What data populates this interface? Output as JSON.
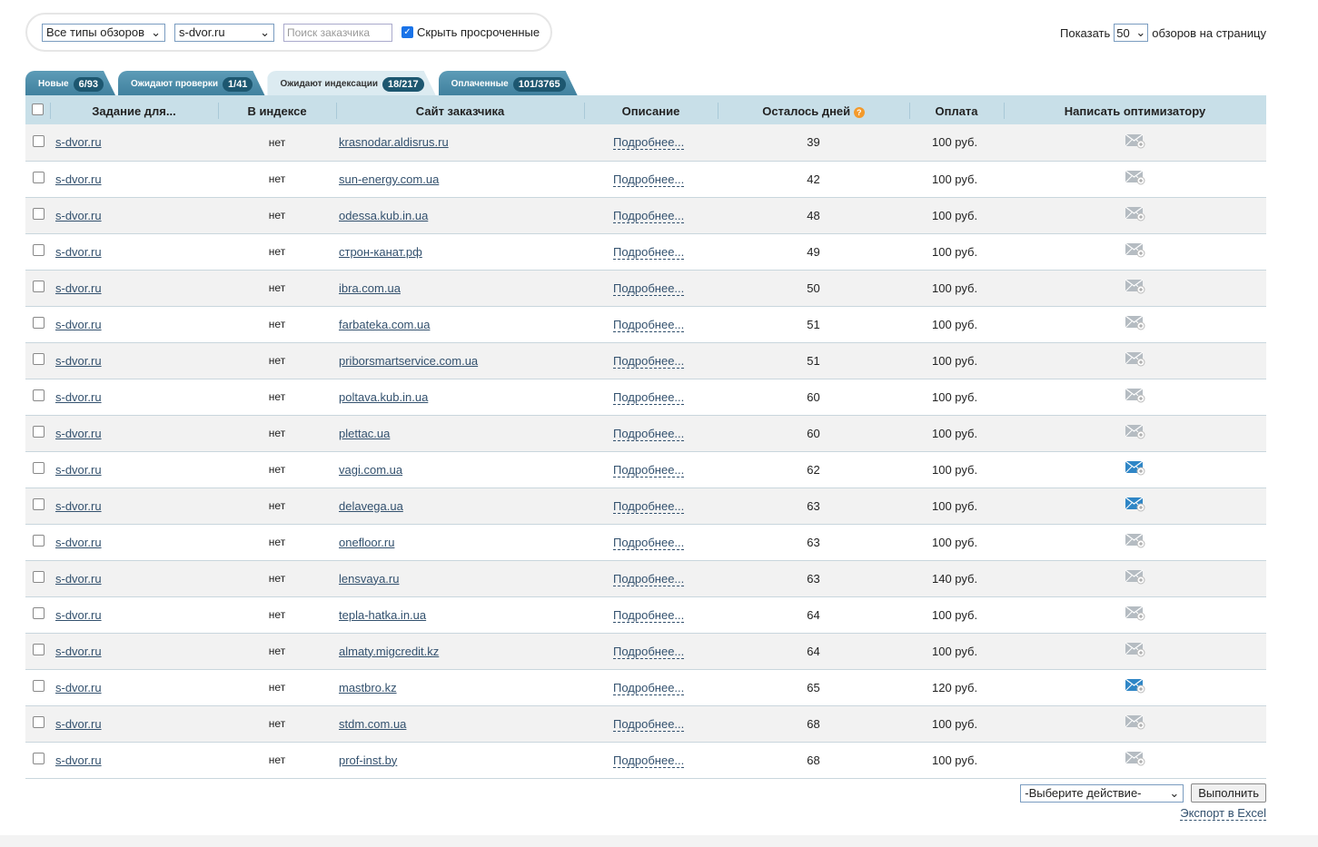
{
  "filters": {
    "review_type": "Все типы обзоров",
    "site": "s-dvor.ru",
    "search_placeholder": "Поиск заказчика",
    "hide_expired_label": "Скрыть просроченные",
    "hide_expired_checked": true
  },
  "per_page": {
    "prefix": "Показать",
    "value": "50",
    "suffix": "обзоров на страницу"
  },
  "tabs": [
    {
      "label": "Новые",
      "count": "6/93"
    },
    {
      "label": "Ожидают проверки",
      "count": "1/41"
    },
    {
      "label": "Ожидают индексации",
      "count": "18/217",
      "active": true
    },
    {
      "label": "Оплаченные",
      "count": "101/3765"
    }
  ],
  "columns": [
    "Задание для...",
    "В индексе",
    "Сайт заказчика",
    "Описание",
    "Осталось дней",
    "Оплата",
    "Написать оптимизатору"
  ],
  "rows": [
    {
      "task": "s-dvor.ru",
      "indexed": "нет",
      "site": "krasnodar.aldisrus.ru",
      "desc": "Подробнее...",
      "days": "39",
      "pay": "100 руб.",
      "msg": "envelope-icon"
    },
    {
      "task": "s-dvor.ru",
      "indexed": "нет",
      "site": "sun-energy.com.ua",
      "desc": "Подробнее...",
      "days": "42",
      "pay": "100 руб.",
      "msg": "envelope-icon"
    },
    {
      "task": "s-dvor.ru",
      "indexed": "нет",
      "site": "odessa.kub.in.ua",
      "desc": "Подробнее...",
      "days": "48",
      "pay": "100 руб.",
      "msg": "envelope-icon"
    },
    {
      "task": "s-dvor.ru",
      "indexed": "нет",
      "site": "строн-канат.рф",
      "desc": "Подробнее...",
      "days": "49",
      "pay": "100 руб.",
      "msg": "envelope-icon"
    },
    {
      "task": "s-dvor.ru",
      "indexed": "нет",
      "site": "ibra.com.ua",
      "desc": "Подробнее...",
      "days": "50",
      "pay": "100 руб.",
      "msg": "envelope-icon"
    },
    {
      "task": "s-dvor.ru",
      "indexed": "нет",
      "site": "farbateka.com.ua",
      "desc": "Подробнее...",
      "days": "51",
      "pay": "100 руб.",
      "msg": "envelope-icon"
    },
    {
      "task": "s-dvor.ru",
      "indexed": "нет",
      "site": "priborsmartservice.com.ua",
      "desc": "Подробнее...",
      "days": "51",
      "pay": "100 руб.",
      "msg": "envelope-icon"
    },
    {
      "task": "s-dvor.ru",
      "indexed": "нет",
      "site": "poltava.kub.in.ua",
      "desc": "Подробнее...",
      "days": "60",
      "pay": "100 руб.",
      "msg": "envelope-icon"
    },
    {
      "task": "s-dvor.ru",
      "indexed": "нет",
      "site": "plettac.ua",
      "desc": "Подробнее...",
      "days": "60",
      "pay": "100 руб.",
      "msg": "envelope-icon"
    },
    {
      "task": "s-dvor.ru",
      "indexed": "нет",
      "site": "vagi.com.ua",
      "desc": "Подробнее...",
      "days": "62",
      "pay": "100 руб.",
      "msg": "envelope-new-icon"
    },
    {
      "task": "s-dvor.ru",
      "indexed": "нет",
      "site": "delavega.ua",
      "desc": "Подробнее...",
      "days": "63",
      "pay": "100 руб.",
      "msg": "envelope-new-icon"
    },
    {
      "task": "s-dvor.ru",
      "indexed": "нет",
      "site": "onefloor.ru",
      "desc": "Подробнее...",
      "days": "63",
      "pay": "100 руб.",
      "msg": "envelope-icon"
    },
    {
      "task": "s-dvor.ru",
      "indexed": "нет",
      "site": "lensvaya.ru",
      "desc": "Подробнее...",
      "days": "63",
      "pay": "140 руб.",
      "msg": "envelope-icon"
    },
    {
      "task": "s-dvor.ru",
      "indexed": "нет",
      "site": "tepla-hatka.in.ua",
      "desc": "Подробнее...",
      "days": "64",
      "pay": "100 руб.",
      "msg": "envelope-icon"
    },
    {
      "task": "s-dvor.ru",
      "indexed": "нет",
      "site": "almaty.migcredit.kz",
      "desc": "Подробнее...",
      "days": "64",
      "pay": "100 руб.",
      "msg": "envelope-icon"
    },
    {
      "task": "s-dvor.ru",
      "indexed": "нет",
      "site": "mastbro.kz",
      "desc": "Подробнее...",
      "days": "65",
      "pay": "120 руб.",
      "msg": "envelope-new-icon"
    },
    {
      "task": "s-dvor.ru",
      "indexed": "нет",
      "site": "stdm.com.ua",
      "desc": "Подробнее...",
      "days": "68",
      "pay": "100 руб.",
      "msg": "envelope-icon"
    },
    {
      "task": "s-dvor.ru",
      "indexed": "нет",
      "site": "prof-inst.by",
      "desc": "Подробнее...",
      "days": "68",
      "pay": "100 руб.",
      "msg": "envelope-icon"
    }
  ],
  "actions": {
    "select": "-Выберите действие-",
    "run": "Выполнить",
    "export": "Экспорт в Excel"
  },
  "colors": {
    "envelope": "#b5bcc2",
    "envelope_new": "#2f86c6",
    "tab": "#4a8aa8",
    "header": "#c8dfe8"
  }
}
